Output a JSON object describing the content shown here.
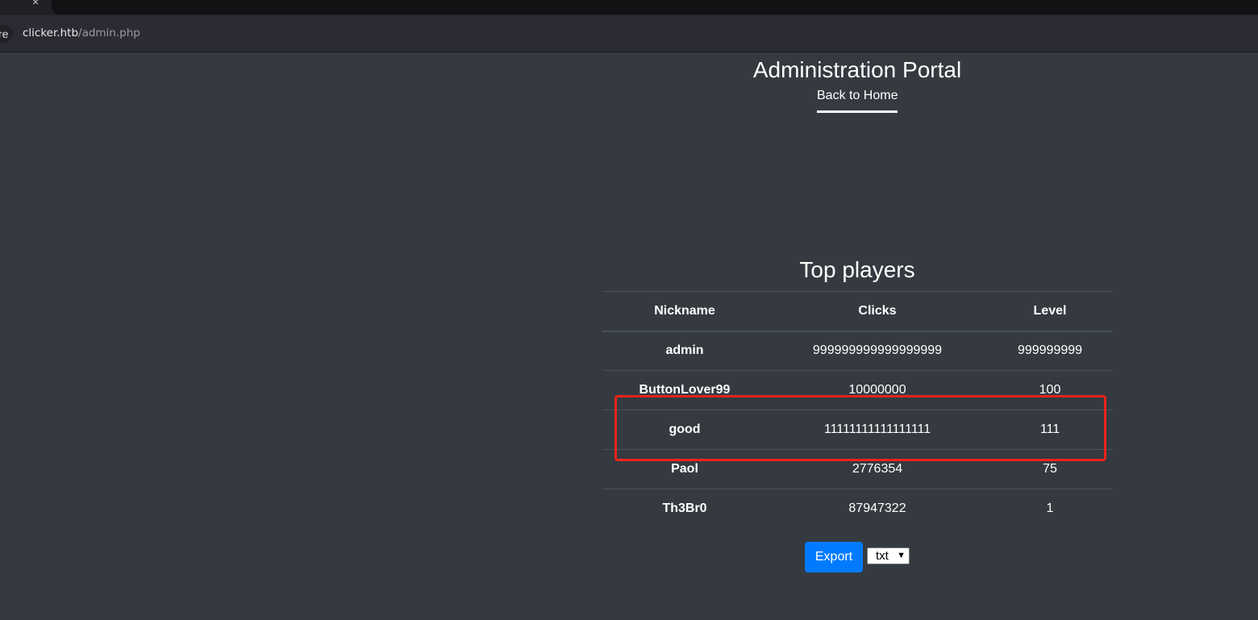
{
  "browser": {
    "secure_label": "re",
    "url_host": "clicker.htb",
    "url_path": "/admin.php"
  },
  "header": {
    "title": "Administration Portal",
    "back_link": "Back to Home"
  },
  "players": {
    "title": "Top players",
    "columns": [
      "Nickname",
      "Clicks",
      "Level"
    ],
    "rows": [
      {
        "nickname": "admin",
        "clicks": "999999999999999999",
        "level": "999999999"
      },
      {
        "nickname": "ButtonLover99",
        "clicks": "10000000",
        "level": "100"
      },
      {
        "nickname": "good",
        "clicks": "11111111111111111",
        "level": "111"
      },
      {
        "nickname": "Paol",
        "clicks": "2776354",
        "level": "75"
      },
      {
        "nickname": "Th3Br0",
        "clicks": "87947322",
        "level": "1"
      }
    ],
    "highlight_color": "#f0231b"
  },
  "export": {
    "button_label": "Export",
    "format_selected": "txt"
  }
}
